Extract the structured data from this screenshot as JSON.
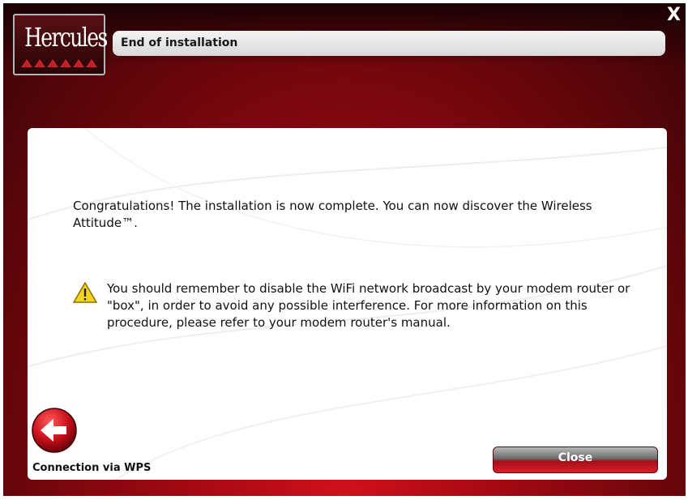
{
  "window": {
    "close_glyph": "X",
    "logo_text": "Hercules",
    "title": "End of installation"
  },
  "content": {
    "message": "Congratulations! The installation is now complete. You can now discover the Wireless Attitude™.",
    "warning_icon": "warning-triangle-icon",
    "warning": "You should remember to disable the WiFi network broadcast by your modem router or \"box\", in order to avoid any possible interference. For more information on this procedure, please refer to your modem router's manual."
  },
  "footer": {
    "back_icon": "back-arrow-icon",
    "back_label": "Connection via WPS",
    "close_label": "Close"
  },
  "colors": {
    "background_dark": "#3a0407",
    "background_red": "#d0101c",
    "title_bar": "#e6e6e6",
    "button_red": "#e01c28",
    "warning_yellow": "#f6d21a"
  }
}
